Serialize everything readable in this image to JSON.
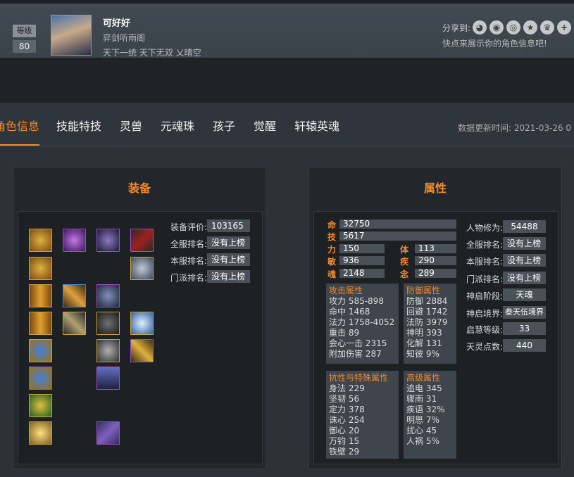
{
  "profile": {
    "level_label": "等级",
    "level": "80",
    "name": "可好好",
    "guild": "弈剑听雨阁",
    "server": "天下一统 天下无双 乂晴空",
    "share_label": "分享到:",
    "share_icons": [
      "wechat-icon",
      "qq-icon",
      "weibo-icon",
      "star-icon",
      "crown-icon",
      "plus-icon"
    ],
    "share_hint": "快点来展示你的角色信息吧!"
  },
  "tabs": {
    "t1": "角色信息",
    "t2": "技能特技",
    "t3": "灵兽",
    "t4": "元魂珠",
    "t5": "孩子",
    "t6": "觉醒",
    "t7": "轩辕英魂",
    "updated": "数据更新时间:  2021-03-26 0"
  },
  "equip": {
    "title": "装备",
    "score_label": "装备评价:",
    "score": "103165",
    "server_rank_label": "全服排名:",
    "server_rank": "没有上榜",
    "local_rank_label": "本服排名:",
    "local_rank": "没有上榜",
    "school_rank_label": "门派排名:",
    "school_rank": "没有上榜"
  },
  "attr": {
    "title": "属性",
    "ming_k": "命",
    "ming": "32750",
    "ji_k": "技",
    "ji": "5617",
    "li_k": "力",
    "li": "150",
    "ti_k": "体",
    "ti": "113",
    "min_k": "敏",
    "min": "936",
    "ji2_k": "疾",
    "ji2": "290",
    "hun_k": "魂",
    "hun": "2148",
    "nian_k": "念",
    "nian": "289",
    "cultivation_label": "人物修为:",
    "cultivation": "54488",
    "server_rank_label": "全服排名:",
    "server_rank": "没有上榜",
    "local_rank_label": "本服排名:",
    "local_rank": "没有上榜",
    "school_rank_label": "门派排名:",
    "school_rank": "没有上榜",
    "god_stage_label": "神启阶段:",
    "god_stage": "天魂",
    "god_realm_label": "神启境界:",
    "god_realm": "叁天伍境界",
    "wisdom_label": "启慧等级:",
    "wisdom": "33",
    "spirit_label": "天灵点数:",
    "spirit": "440",
    "attack_title": "攻击属性",
    "attack": [
      "攻力 585-898",
      "命中 1468",
      "法力 1758-4052",
      "重击 89",
      "会心一击 2315",
      "附加伤害 287"
    ],
    "defense_title": "防御属性",
    "defense": [
      "防御 2884",
      "回避 1742",
      "法防 3979",
      "神明 393",
      "化解 131",
      "知彼 9%"
    ],
    "resist_title": "抗性与特殊属性",
    "resist": [
      "身法 229",
      "坚韧 56",
      "定力 378",
      "诛心 254",
      "御心 20",
      "万钧 15",
      "铁壁 29"
    ],
    "advanced_title": "高级属性",
    "advanced": [
      "追电 345",
      "骤雨 31",
      "疾语 32%",
      "明思 7%",
      "扰心 45",
      "人祸 5%"
    ]
  },
  "colors": {
    "accent": "#f08a2a",
    "panel": "#23262a",
    "field": "#4a5158"
  }
}
